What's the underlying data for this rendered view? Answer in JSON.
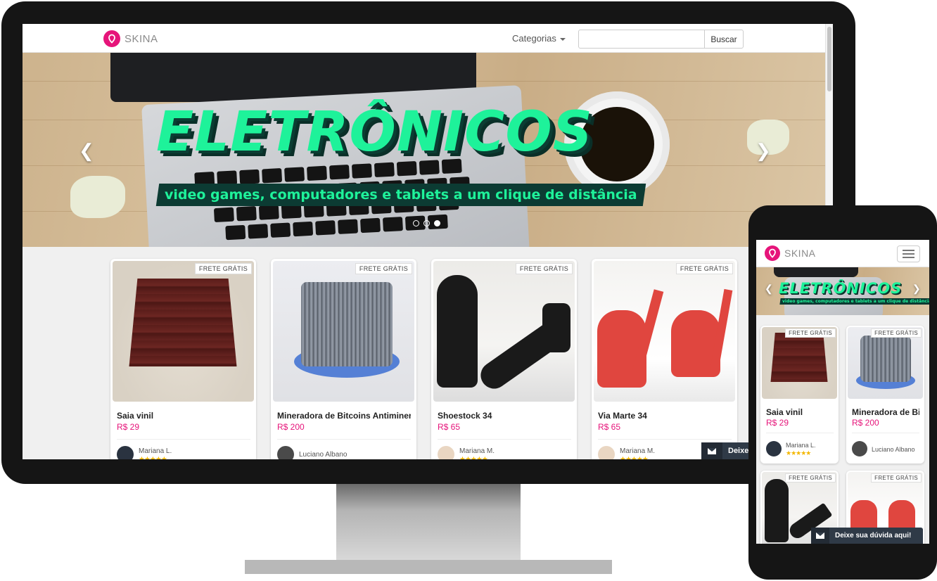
{
  "brand": {
    "name": "SKINA",
    "accent": "#e6147a"
  },
  "nav": {
    "categories_label": "Categorias",
    "search_placeholder": "",
    "search_button": "Buscar"
  },
  "hero": {
    "title": "ELETRÔNICOS",
    "subtitle": "video games, computadores e tablets a um clique de distância",
    "title_color": "#1ef29a",
    "subtitle_bg": "#0c3b33",
    "prev_icon": "chevron-left-icon",
    "next_icon": "chevron-right-icon"
  },
  "products": [
    {
      "badge": "FRETE GRÁTIS",
      "title": "Saia vinil",
      "price": "R$ 29",
      "seller": "Mariana L.",
      "stars": "★★★★★"
    },
    {
      "badge": "FRETE GRÁTIS",
      "title": "Mineradora de Bitcoins Antiminer",
      "price": "R$ 200",
      "seller": "Luciano Albano",
      "stars": ""
    },
    {
      "badge": "FRETE GRÁTIS",
      "title": "Shoestock 34",
      "price": "R$ 65",
      "seller": "Mariana M.",
      "stars": "★★★★★"
    },
    {
      "badge": "FRETE GRÁTIS",
      "title": "Via Marte 34",
      "price": "R$ 65",
      "seller": "Mariana M.",
      "stars": "★★★★★"
    }
  ],
  "mobile_products": [
    {
      "badge": "FRETE GRÁTIS",
      "title": "Saia vinil",
      "price": "R$ 29",
      "seller": "Mariana L.",
      "stars": "★★★★★"
    },
    {
      "badge": "FRETE GRÁTIS",
      "title": "Mineradora de Bitcoins",
      "price": "R$ 200",
      "seller": "Luciano Albano",
      "stars": ""
    },
    {
      "badge": "FRETE GRÁTIS"
    },
    {
      "badge": "FRETE GRÁTIS"
    }
  ],
  "chat": {
    "desktop_label": "Deixe",
    "mobile_label": "Deixe sua dúvida aqui!",
    "icon": "envelope-icon"
  }
}
